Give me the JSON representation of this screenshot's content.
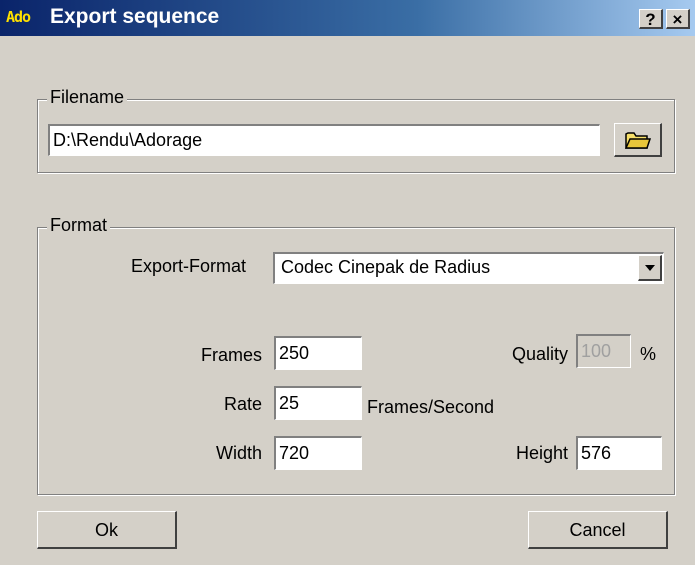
{
  "window": {
    "icon_text": "Ado",
    "title": "Export sequence",
    "help_label": "?",
    "close_label": "×"
  },
  "filename_group": {
    "legend": "Filename",
    "path_value": "D:\\Rendu\\Adorage",
    "browse_icon": "folder-icon"
  },
  "format_group": {
    "legend": "Format",
    "export_format_label": "Export-Format",
    "export_format_value": "Codec Cinepak de Radius",
    "frames_label": "Frames",
    "frames_value": "250",
    "quality_label": "Quality",
    "quality_value": "100",
    "quality_unit": "%",
    "rate_label": "Rate",
    "rate_value": "25",
    "rate_unit": "Frames/Second",
    "width_label": "Width",
    "width_value": "720",
    "height_label": "Height",
    "height_value": "576"
  },
  "buttons": {
    "ok_label": "Ok",
    "cancel_label": "Cancel"
  }
}
